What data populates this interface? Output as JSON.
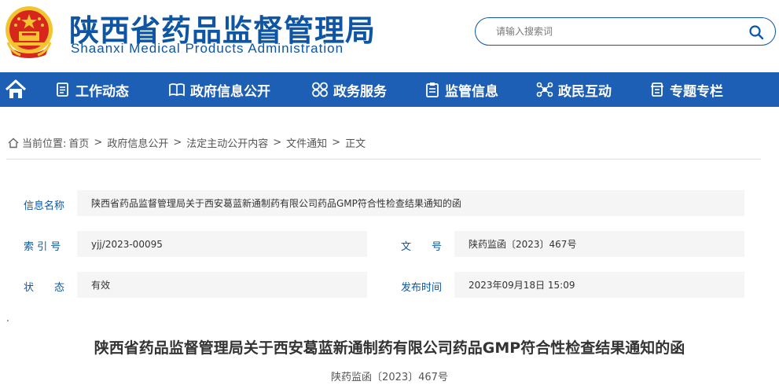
{
  "header": {
    "title_cn": "陕西省药品监督管理局",
    "title_en": "Shaanxi Medical Products Administration",
    "emblem": "national-emblem-icon",
    "search_placeholder": "请输入搜索词"
  },
  "nav": {
    "home_icon": "home-icon",
    "items": [
      {
        "label": "工作动态",
        "icon": "document-list-icon"
      },
      {
        "label": "政府信息公开",
        "icon": "book-icon"
      },
      {
        "label": "政务服务",
        "icon": "grid-icon"
      },
      {
        "label": "监管信息",
        "icon": "clipboard-icon"
      },
      {
        "label": "政民互动",
        "icon": "interaction-icon"
      },
      {
        "label": "专题专栏",
        "icon": "folder-icon"
      }
    ]
  },
  "breadcrumb": {
    "prefix": "当前位置:",
    "items": [
      "首页",
      "政府信息公开",
      "法定主动公开内容",
      "文件通知",
      "正文"
    ],
    "separator": ">"
  },
  "info": {
    "name_label": "信息名称",
    "name_value": "陕西省药品监督管理局关于西安葛蓝新通制药有限公司药品GMP符合性检查结果通知的函",
    "index_label": "索 引 号",
    "index_value": "yjj/2023-00095",
    "docno_label": "文　　号",
    "docno_value": "陕药监函〔2023〕467号",
    "status_label": "状　　态",
    "status_value": "有效",
    "date_label": "发布时间",
    "date_value": "2023年09月18日 15:09"
  },
  "dot": ".",
  "document": {
    "title": "陕西省药品监督管理局关于西安葛蓝新通制药有限公司药品GMP符合性检查结果通知的函",
    "number": "陕药监函〔2023〕467号"
  },
  "colors": {
    "brand_blue": "#0e56a4",
    "nav_blue": "#1d5fb4",
    "emblem_red": "#d7261b",
    "emblem_gold": "#f4c430"
  }
}
